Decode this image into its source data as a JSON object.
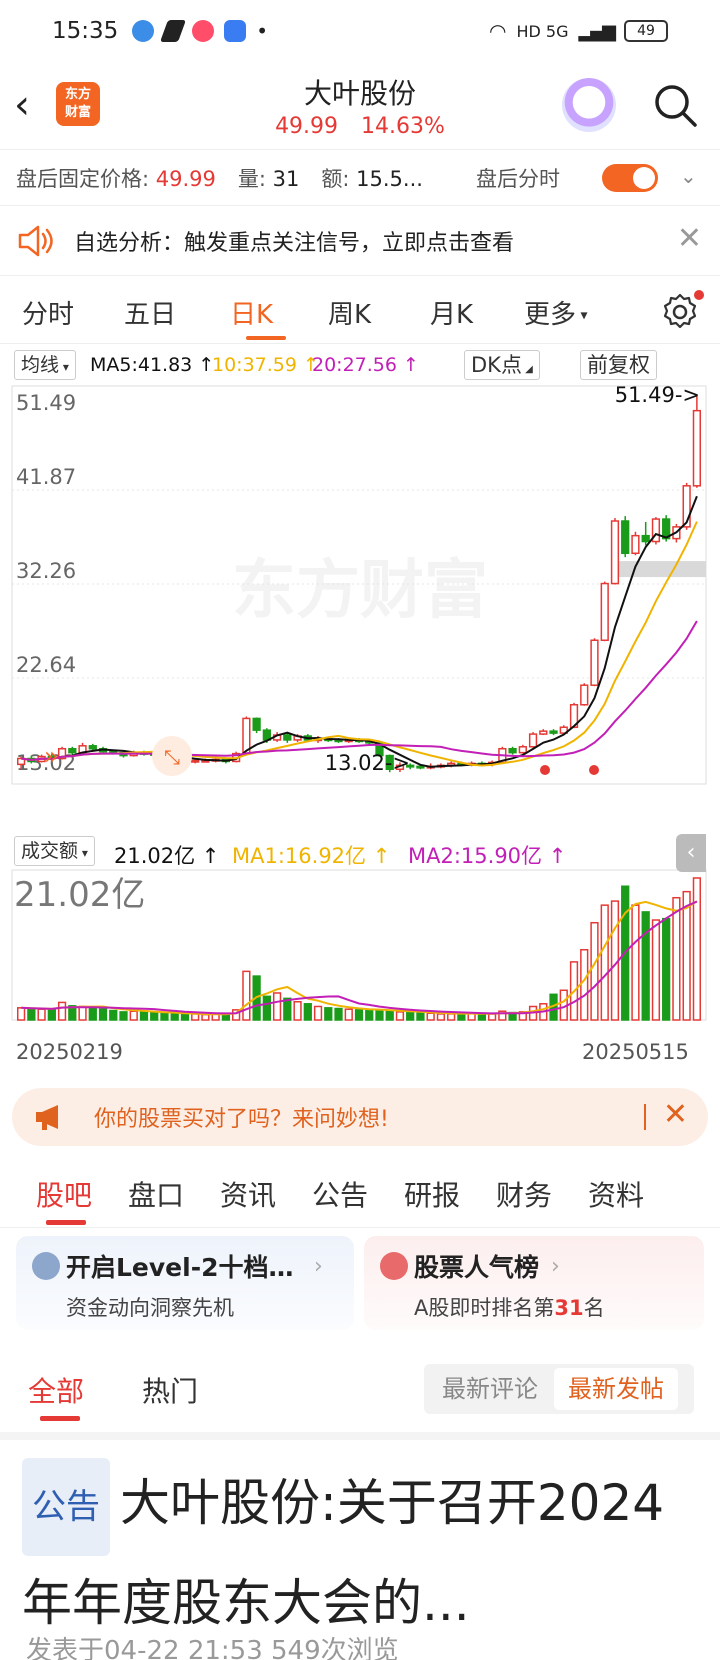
{
  "status_bar": {
    "time": "15:35",
    "network": "HD 5G",
    "battery": "49"
  },
  "header": {
    "back_label": "‹",
    "logo_text": "东方\n财富",
    "stock_name": "大叶股份",
    "price": "49.99",
    "change_pct": "14.63%"
  },
  "after_hours": {
    "price_label": "盘后固定价格:",
    "price": "49.99",
    "vol_label": "量:",
    "vol": "31",
    "amt_label": "额:",
    "amt": "15.5...",
    "tick_label": "盘后分时"
  },
  "notice": {
    "text": "自选分析：触发重点关注信号，立即点击查看"
  },
  "ktabs": [
    "分时",
    "五日",
    "日K",
    "周K",
    "月K",
    "更多"
  ],
  "ma_row": {
    "select": "均线",
    "ma5": "MA5:41.83",
    "ma10": "10:37.59",
    "ma20": "20:27.56",
    "dk": "DK点",
    "adjust": "前复权"
  },
  "chart": {
    "y_labels": [
      "51.49",
      "41.87",
      "32.26",
      "22.64",
      "13.02"
    ],
    "high_marker": "51.49->",
    "low_marker": "13.02->",
    "watermark": "东方财富"
  },
  "volume": {
    "select": "成交额",
    "value": "21.02亿",
    "ma1": "MA1:16.92亿",
    "ma2": "MA2:15.90亿",
    "max_label": "21.02亿"
  },
  "dates": {
    "start": "20250219",
    "end": "20250515"
  },
  "ai_banner": {
    "text": "你的股票买对了吗？来问妙想!"
  },
  "sub_tabs": [
    "股吧",
    "盘口",
    "资讯",
    "公告",
    "研报",
    "财务",
    "资料"
  ],
  "cards": {
    "left_title": "开启Level-2十档行...",
    "left_sub": "资金动向洞察先机",
    "right_title": "股票人气榜",
    "right_sub_pre": "A股即时排名第",
    "right_rank": "31",
    "right_sub_post": "名"
  },
  "filter": {
    "all": "全部",
    "hot": "热门",
    "latest_comment": "最新评论",
    "latest_post": "最新发帖"
  },
  "post": {
    "tag": "公告",
    "title": "大叶股份:关于召开2024年年度股东大会的...",
    "meta": "发表于04-22 21:53   549次浏览"
  },
  "colors": {
    "accent": "#f26522",
    "up": "#e53935",
    "down": "#1a9b1a",
    "ma5": "#111111",
    "ma10": "#f0b400",
    "ma20": "#c21fb7"
  },
  "chart_data": {
    "type": "candlestick",
    "ylim": [
      13.02,
      51.49
    ],
    "candles": [
      [
        13.8,
        14.4,
        13.3,
        14.6
      ],
      [
        14.4,
        14.1,
        13.9,
        14.7
      ],
      [
        14.1,
        14.6,
        14.0,
        14.8
      ],
      [
        14.6,
        14.4,
        14.1,
        14.9
      ],
      [
        14.4,
        15.4,
        14.3,
        15.6
      ],
      [
        15.4,
        15.0,
        14.8,
        15.6
      ],
      [
        15.0,
        15.7,
        14.9,
        16.0
      ],
      [
        15.7,
        15.4,
        15.1,
        15.9
      ],
      [
        15.4,
        15.1,
        14.9,
        15.6
      ],
      [
        15.1,
        15.0,
        14.8,
        15.3
      ],
      [
        15.0,
        14.7,
        14.5,
        15.2
      ],
      [
        14.7,
        15.0,
        14.6,
        15.2
      ],
      [
        15.0,
        14.9,
        14.7,
        15.2
      ],
      [
        14.9,
        14.8,
        14.6,
        15.1
      ],
      [
        14.8,
        14.5,
        14.3,
        15.0
      ],
      [
        14.5,
        14.3,
        14.1,
        14.7
      ],
      [
        14.3,
        14.1,
        14.0,
        14.5
      ],
      [
        14.1,
        14.2,
        13.9,
        14.4
      ],
      [
        14.2,
        14.2,
        14.0,
        14.4
      ],
      [
        14.2,
        14.3,
        14.0,
        14.5
      ],
      [
        14.3,
        14.1,
        13.9,
        14.5
      ],
      [
        14.1,
        14.9,
        14.0,
        15.1
      ],
      [
        14.9,
        18.5,
        14.8,
        18.7
      ],
      [
        18.5,
        17.3,
        17.0,
        18.6
      ],
      [
        17.3,
        16.3,
        16.0,
        17.5
      ],
      [
        16.3,
        16.8,
        16.1,
        17.1
      ],
      [
        16.8,
        16.3,
        16.0,
        17.0
      ],
      [
        16.3,
        16.7,
        16.1,
        16.9
      ],
      [
        16.7,
        16.3,
        16.1,
        16.9
      ],
      [
        16.3,
        16.4,
        16.0,
        16.7
      ],
      [
        16.4,
        16.3,
        16.1,
        16.6
      ],
      [
        16.3,
        16.2,
        16.0,
        16.5
      ],
      [
        16.2,
        16.3,
        16.0,
        16.5
      ],
      [
        16.3,
        16.2,
        16.0,
        16.5
      ],
      [
        16.2,
        16.0,
        15.8,
        16.4
      ],
      [
        16.0,
        14.7,
        14.6,
        16.0
      ],
      [
        14.7,
        13.3,
        13.0,
        14.8
      ],
      [
        13.3,
        13.7,
        13.02,
        14.0
      ],
      [
        13.7,
        13.6,
        13.3,
        13.9
      ],
      [
        13.6,
        13.5,
        13.3,
        13.8
      ],
      [
        13.5,
        13.6,
        13.3,
        13.9
      ],
      [
        13.6,
        13.7,
        13.4,
        13.9
      ],
      [
        13.7,
        13.9,
        13.5,
        14.1
      ],
      [
        13.9,
        13.8,
        13.6,
        14.1
      ],
      [
        13.8,
        13.9,
        13.6,
        14.1
      ],
      [
        13.9,
        13.8,
        13.6,
        14.1
      ],
      [
        13.8,
        14.0,
        13.6,
        14.2
      ],
      [
        14.0,
        15.4,
        13.9,
        15.6
      ],
      [
        15.4,
        15.0,
        14.8,
        15.6
      ],
      [
        15.0,
        15.6,
        14.9,
        15.8
      ],
      [
        15.6,
        16.9,
        15.5,
        17.1
      ],
      [
        16.9,
        17.2,
        16.8,
        17.4
      ],
      [
        17.2,
        17.0,
        16.8,
        17.4
      ],
      [
        17.0,
        17.6,
        16.9,
        17.8
      ],
      [
        17.6,
        19.9,
        17.5,
        20.1
      ],
      [
        19.9,
        21.9,
        19.8,
        22.1
      ],
      [
        21.9,
        26.5,
        21.8,
        26.7
      ],
      [
        26.5,
        32.3,
        26.4,
        32.5
      ],
      [
        32.3,
        38.7,
        32.2,
        39.0
      ],
      [
        38.7,
        35.4,
        35.0,
        39.2
      ],
      [
        35.4,
        37.2,
        35.2,
        37.6
      ],
      [
        37.2,
        36.6,
        36.2,
        38.6
      ],
      [
        36.6,
        38.9,
        36.3,
        39.1
      ],
      [
        38.9,
        36.9,
        36.6,
        39.3
      ],
      [
        36.9,
        38.1,
        36.5,
        38.4
      ],
      [
        38.1,
        42.3,
        37.8,
        42.6
      ],
      [
        42.3,
        49.99,
        42.1,
        51.49
      ]
    ],
    "volume": [
      1.8,
      1.7,
      1.6,
      1.5,
      2.6,
      2.1,
      2.0,
      1.7,
      1.6,
      1.4,
      1.2,
      1.3,
      1.2,
      1.1,
      1.0,
      0.9,
      0.8,
      0.9,
      0.8,
      0.9,
      0.9,
      1.5,
      7.2,
      6.5,
      3.5,
      4.0,
      3.2,
      2.7,
      2.4,
      2.0,
      1.8,
      1.7,
      1.6,
      1.5,
      1.4,
      1.5,
      1.3,
      1.2,
      1.1,
      1.0,
      1.0,
      0.9,
      0.9,
      0.9,
      1.0,
      0.9,
      0.9,
      1.3,
      1.1,
      1.2,
      2.0,
      2.4,
      3.8,
      4.4,
      8.6,
      10.4,
      14.4,
      17.0,
      17.6,
      19.8,
      17.0,
      16.0,
      14.8,
      15.0,
      18.1,
      19.0,
      21.02
    ],
    "ma5_end": 41.83,
    "ma10_end": 37.59,
    "ma20_end": 27.56
  }
}
